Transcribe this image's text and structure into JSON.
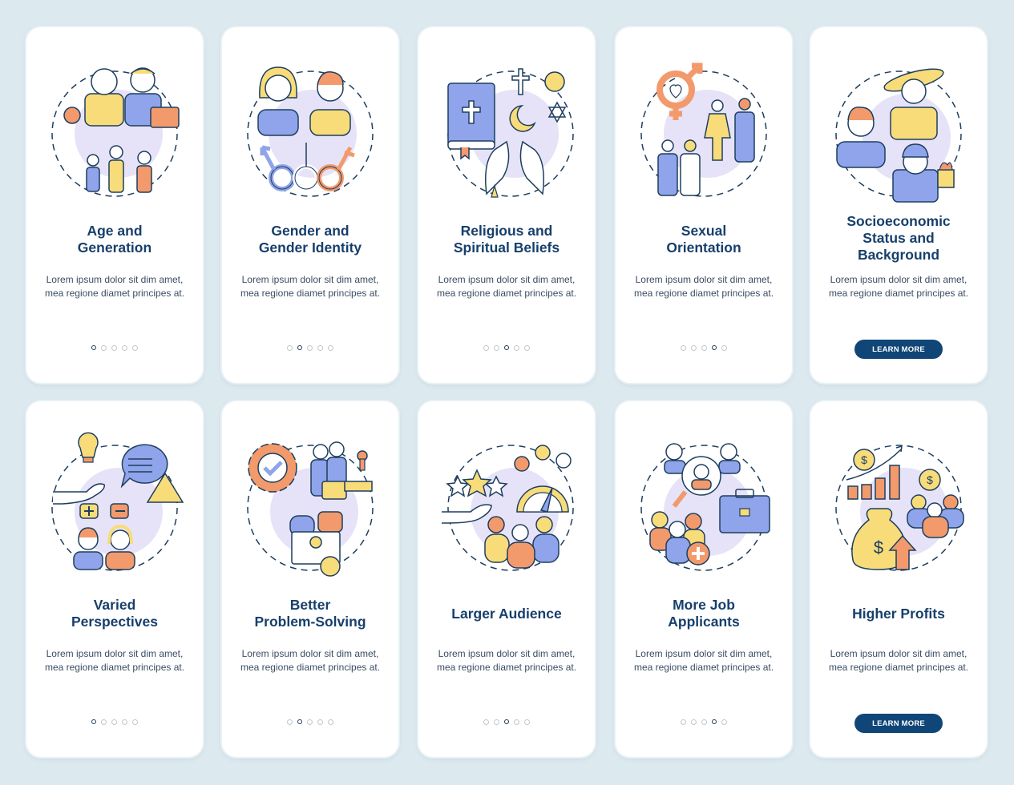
{
  "colors": {
    "background": "#dce9ef",
    "card": "#ffffff",
    "title": "#173f6b",
    "body_text": "#3b4d63",
    "button": "#104677",
    "accent_blue": "#8fa4ea",
    "accent_yellow": "#f8dc7a",
    "accent_orange": "#f29a6c",
    "accent_lavender": "#e6e3f8",
    "outline": "#1d3e5e"
  },
  "cards": [
    {
      "title": "Age and Generation",
      "title_lines": [
        "Age and",
        "Generation"
      ],
      "description": "Lorem ipsum dolor sit dim amet, mea regione diamet principes at.",
      "icon": "age-generation-illustration",
      "active_step": 1,
      "total_steps": 5
    },
    {
      "title": "Gender and Gender Identity",
      "title_lines": [
        "Gender and",
        "Gender Identity"
      ],
      "description": "Lorem ipsum dolor sit dim amet, mea regione diamet principes at.",
      "icon": "gender-identity-illustration",
      "active_step": 2,
      "total_steps": 5
    },
    {
      "title": "Religious and Spiritual Beliefs",
      "title_lines": [
        "Religious and",
        "Spiritual Beliefs"
      ],
      "description": "Lorem ipsum dolor sit dim amet, mea regione diamet principes at.",
      "icon": "religious-beliefs-illustration",
      "active_step": 3,
      "total_steps": 5
    },
    {
      "title": "Sexual Orientation",
      "title_lines": [
        "Sexual",
        "Orientation"
      ],
      "description": "Lorem ipsum dolor sit dim amet, mea regione diamet principes at.",
      "icon": "sexual-orientation-illustration",
      "active_step": 4,
      "total_steps": 5
    },
    {
      "title": "Socioeconomic Status and Background",
      "title_lines": [
        "Socioeconomic",
        "Status and",
        "Background"
      ],
      "description": "Lorem ipsum dolor sit dim amet, mea regione diamet principes at.",
      "icon": "socioeconomic-illustration",
      "button_label": "LEARN MORE"
    },
    {
      "title": "Varied Perspectives",
      "title_lines": [
        "Varied",
        "Perspectives"
      ],
      "description": "Lorem ipsum dolor sit dim amet, mea regione diamet principes at.",
      "icon": "perspectives-illustration",
      "active_step": 1,
      "total_steps": 5
    },
    {
      "title": "Better Problem-Solving",
      "title_lines": [
        "Better",
        "Problem-Solving"
      ],
      "description": "Lorem ipsum dolor sit dim amet, mea regione diamet principes at.",
      "icon": "problem-solving-illustration",
      "active_step": 2,
      "total_steps": 5
    },
    {
      "title": "Larger Audience",
      "title_lines": [
        "Larger Audience"
      ],
      "description": "Lorem ipsum dolor sit dim amet, mea regione diamet principes at.",
      "icon": "audience-illustration",
      "active_step": 3,
      "total_steps": 5
    },
    {
      "title": "More Job Applicants",
      "title_lines": [
        "More Job",
        "Applicants"
      ],
      "description": "Lorem ipsum dolor sit dim amet, mea regione diamet principes at.",
      "icon": "job-applicants-illustration",
      "active_step": 4,
      "total_steps": 5
    },
    {
      "title": "Higher Profits",
      "title_lines": [
        "Higher Profits"
      ],
      "description": "Lorem ipsum dolor sit dim amet, mea regione diamet principes at.",
      "icon": "profits-illustration",
      "button_label": "LEARN MORE"
    }
  ]
}
